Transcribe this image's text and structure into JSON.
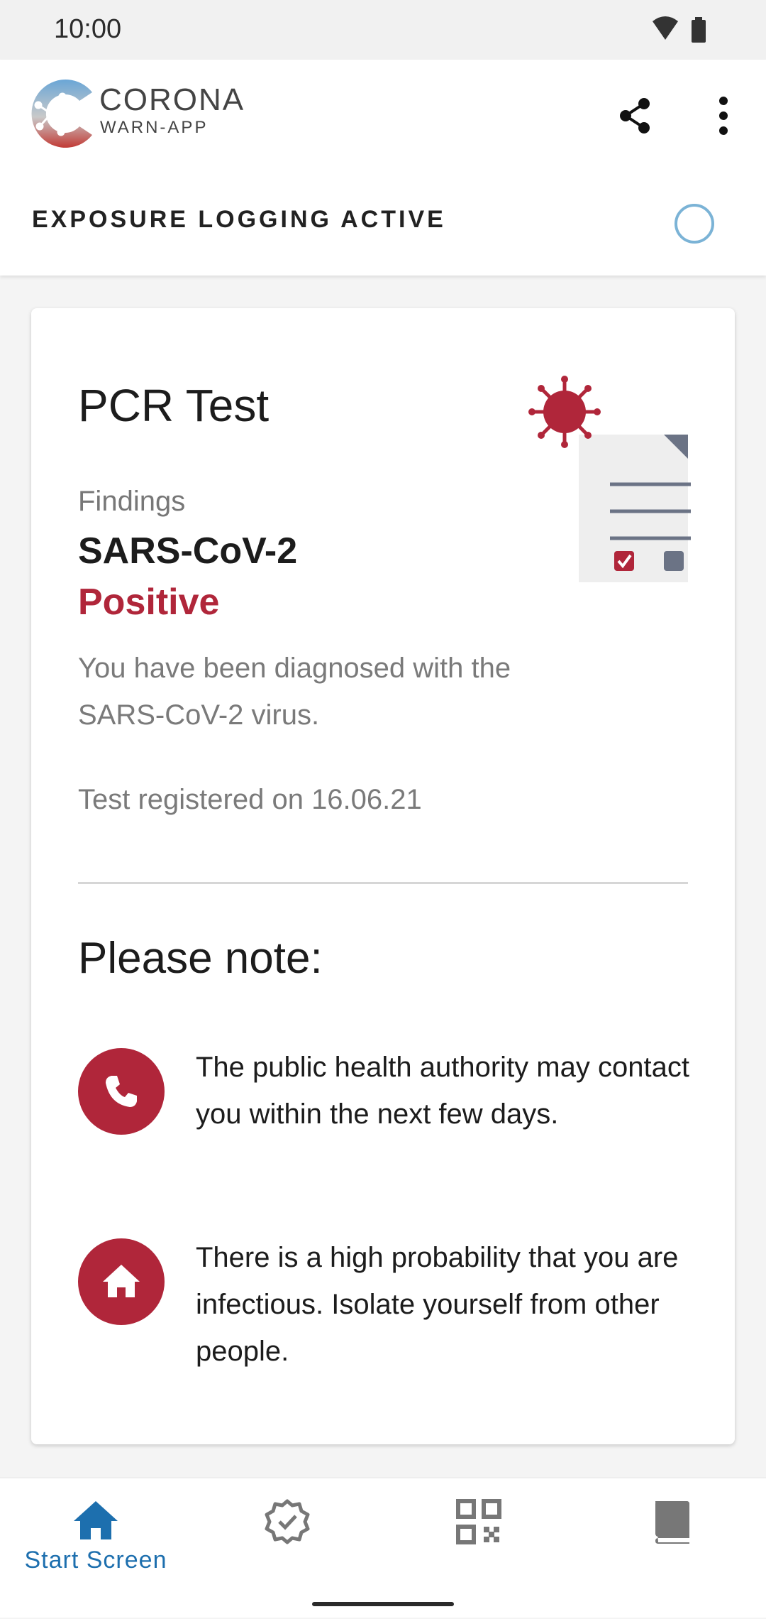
{
  "status_bar": {
    "time": "10:00",
    "icons": [
      "wifi-icon",
      "battery-icon"
    ]
  },
  "header": {
    "logo_title": "CORONA",
    "logo_subtitle": "WARN-APP",
    "actions": [
      "share-icon",
      "more-vert-icon"
    ]
  },
  "exposure": {
    "label": "EXPOSURE LOGGING ACTIVE",
    "indicator": "ring-icon"
  },
  "card": {
    "title": "PCR Test",
    "findings_label": "Findings",
    "virus_name": "SARS-CoV-2",
    "result": "Positive",
    "diagnosis": "You have been diagnosed with the SARS-CoV-2 virus.",
    "registered": "Test registered on 16.06.21",
    "illustration": "test-document-virus-icon",
    "note_heading": "Please note:",
    "notes": [
      {
        "icon": "phone-icon",
        "text": "The public health authority may contact you within the next few days."
      },
      {
        "icon": "home-icon",
        "text": "There is a high probability that you are infectious. Isolate yourself from other people."
      }
    ]
  },
  "bottom_nav": {
    "items": [
      {
        "icon": "home-icon",
        "label": "Start Screen",
        "active": true
      },
      {
        "icon": "certificate-check-icon",
        "label": "",
        "active": false
      },
      {
        "icon": "qr-code-icon",
        "label": "",
        "active": false
      },
      {
        "icon": "diary-book-icon",
        "label": "",
        "active": false
      }
    ]
  },
  "colors": {
    "accent_red": "#b0263a",
    "nav_blue": "#1d6fae",
    "ring_blue": "#7bb3d6"
  }
}
